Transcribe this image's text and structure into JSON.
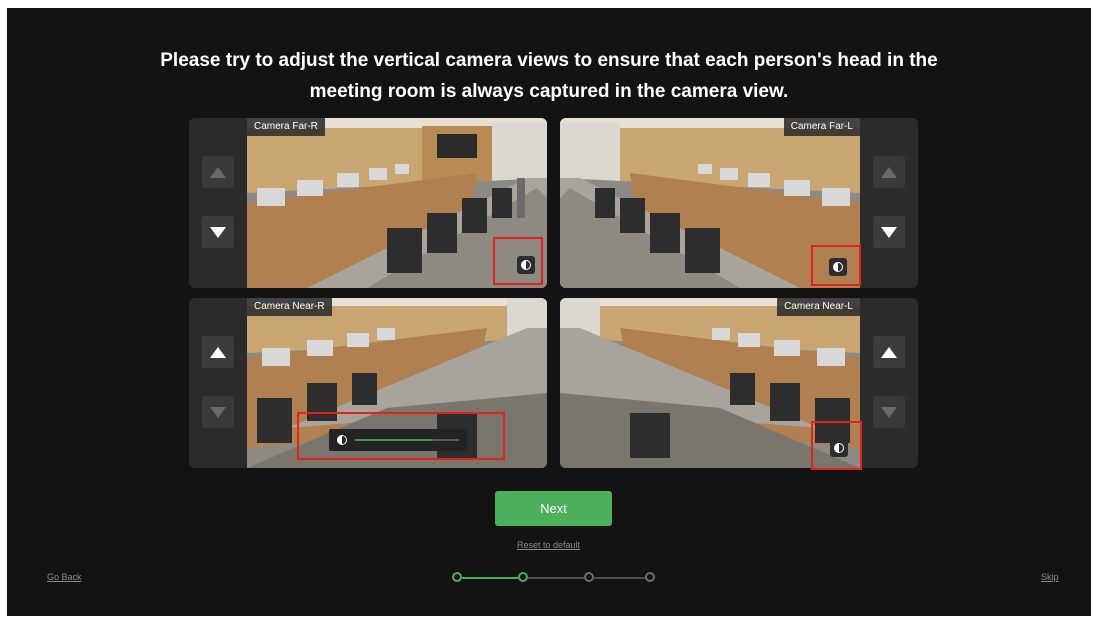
{
  "title": {
    "line1": "Please try to adjust the vertical camera views to ensure that each person's head in the",
    "line2": "meeting room is always captured in the camera view."
  },
  "cameras": [
    {
      "label": "Camera Far-R",
      "up_enabled": false,
      "down_enabled": true
    },
    {
      "label": "Camera Far-L",
      "up_enabled": false,
      "down_enabled": true
    },
    {
      "label": "Camera Near-R",
      "up_enabled": true,
      "down_enabled": false
    },
    {
      "label": "Camera Near-L",
      "up_enabled": true,
      "down_enabled": false
    }
  ],
  "brightness_slider": {
    "value_percent": 75
  },
  "next_label": "Next",
  "reset_label": "Reset to default",
  "go_back_label": "Go Back",
  "skip_label": "Skip",
  "progress": {
    "total_steps": 4,
    "current_step": 2
  },
  "colors": {
    "accent": "#4caf59",
    "highlight": "#e3221c",
    "background": "#131313"
  }
}
